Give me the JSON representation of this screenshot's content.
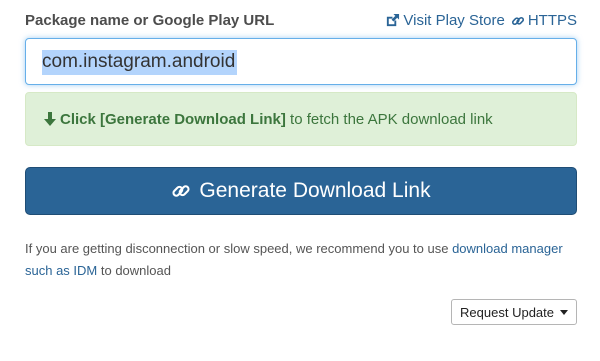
{
  "form": {
    "label": "Package name or Google Play URL",
    "input_value": "com.instagram.android"
  },
  "links": {
    "play_store": "Visit Play Store",
    "https": "HTTPS"
  },
  "hint": {
    "bold": "Click [Generate Download Link]",
    "rest": " to fetch the APK download link"
  },
  "generate_button": "Generate Download Link",
  "note": {
    "text_before": "If you are getting disconnection or slow speed, we recommend you to use ",
    "link": "download manager such as IDM",
    "text_after": " to download"
  },
  "request_update": "Request Update",
  "colors": {
    "primary": "#2a6496",
    "hint_bg": "#dff0d8",
    "hint_text": "#3c763d"
  },
  "icons": [
    "external-link-icon",
    "link-icon",
    "arrow-down-icon",
    "caret-down-icon"
  ]
}
